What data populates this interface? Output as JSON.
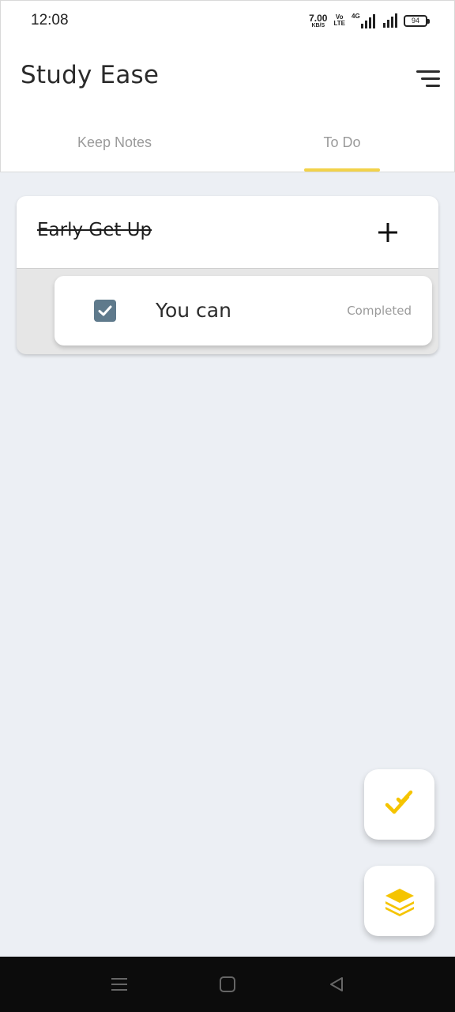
{
  "status_bar": {
    "time": "12:08",
    "net_speed_value": "7.00",
    "net_speed_unit": "KB/S",
    "volte_top": "Vo",
    "volte_bottom": "LTE",
    "network_type": "4G",
    "battery_percent": "94"
  },
  "header": {
    "title": "Study Ease",
    "menu_icon": "menu-lines-icon"
  },
  "tabs": [
    {
      "label": "Keep Notes",
      "selected": false
    },
    {
      "label": "To Do",
      "selected": true
    }
  ],
  "colors": {
    "accent": "#f2d24a",
    "checkbox": "#5f7a8c",
    "fab_icon": "#f5c400",
    "background": "#eceff4"
  },
  "todo_group": {
    "title": "Early Get Up",
    "title_struck_through": true,
    "add_icon": "plus-icon",
    "tasks": [
      {
        "label": "You can",
        "status": "Completed",
        "checked": true
      }
    ]
  },
  "fabs": [
    {
      "name": "todo",
      "icon": "double-check-icon"
    },
    {
      "name": "notes",
      "icon": "layers-icon"
    }
  ],
  "nav_bar": {
    "icons": [
      "menu-icon",
      "home-square-icon",
      "back-triangle-icon"
    ]
  }
}
